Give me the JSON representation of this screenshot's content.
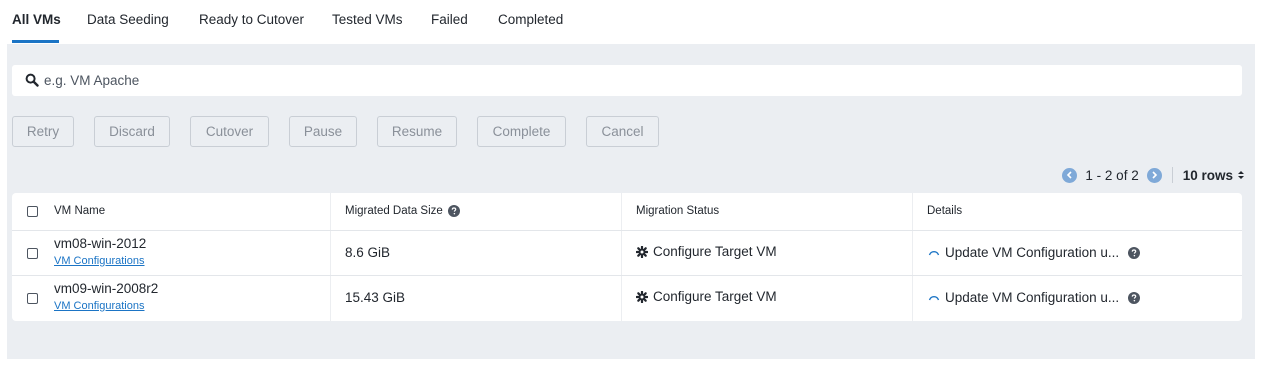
{
  "tabs": [
    {
      "label": "All VMs",
      "active": true
    },
    {
      "label": "Data Seeding",
      "active": false
    },
    {
      "label": "Ready to Cutover",
      "active": false
    },
    {
      "label": "Tested VMs",
      "active": false
    },
    {
      "label": "Failed",
      "active": false
    },
    {
      "label": "Completed",
      "active": false
    }
  ],
  "search": {
    "placeholder": "e.g. VM Apache",
    "value": ""
  },
  "actions": {
    "retry": "Retry",
    "discard": "Discard",
    "cutover": "Cutover",
    "pause": "Pause",
    "resume": "Resume",
    "complete": "Complete",
    "cancel": "Cancel"
  },
  "pagination": {
    "range": "1 - 2 of 2",
    "rows_per_page": "10 rows"
  },
  "table": {
    "headers": {
      "vm_name": "VM Name",
      "migrated_size": "Migrated Data Size",
      "migration_status": "Migration Status",
      "details": "Details"
    },
    "rows": [
      {
        "vm_name": "vm08-win-2012",
        "config_link": "VM Configurations",
        "migrated_size": "8.6 GiB",
        "migration_status": "Configure Target VM",
        "details": "Update VM Configuration u...",
        "checked": false
      },
      {
        "vm_name": "vm09-win-2008r2",
        "config_link": "VM Configurations",
        "migrated_size": "15.43 GiB",
        "migration_status": "Configure Target VM",
        "details": "Update VM Configuration u...",
        "checked": false
      }
    ]
  },
  "colors": {
    "accent": "#1b74c5",
    "panel_bg": "#ebeef2",
    "disabled_text": "#8a9099",
    "pager_arrow": "#7fa9d8"
  },
  "icons": {
    "search": "search-icon",
    "help": "question-circle-icon",
    "status": "gear-icon",
    "details": "spinner-icon",
    "prev": "chevron-left-circle-icon",
    "next": "chevron-right-circle-icon",
    "rows": "sort-caret-icon"
  }
}
